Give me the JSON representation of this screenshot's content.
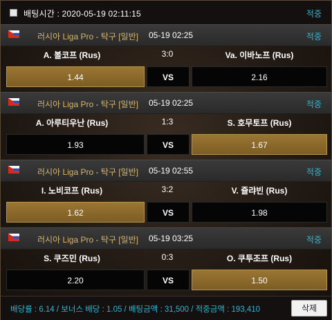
{
  "header": {
    "bet_time": "배팅시간 : 2020-05-19 02:11:15",
    "hit_label": "적중"
  },
  "games": [
    {
      "league": "러시아 Liga Pro - 탁구 [일반]",
      "time": "05-19 02:25",
      "hit_label": "적중",
      "home_team": "A. 볼코프 (Rus)",
      "score": "3:0",
      "away_team": "Va. 이바노프 (Rus)",
      "home_odds": "1.44",
      "vs_label": "VS",
      "away_odds": "2.16",
      "selected": "home"
    },
    {
      "league": "러시아 Liga Pro - 탁구 [일반]",
      "time": "05-19 02:25",
      "hit_label": "적중",
      "home_team": "A. 아루티우난 (Rus)",
      "score": "1:3",
      "away_team": "S. 호무토프 (Rus)",
      "home_odds": "1.93",
      "vs_label": "VS",
      "away_odds": "1.67",
      "selected": "away"
    },
    {
      "league": "러시아 Liga Pro - 탁구 [일반]",
      "time": "05-19 02:55",
      "hit_label": "적중",
      "home_team": "I. 노비코프 (Rus)",
      "score": "3:2",
      "away_team": "V. 쥴랴빈 (Rus)",
      "home_odds": "1.62",
      "vs_label": "VS",
      "away_odds": "1.98",
      "selected": "home"
    },
    {
      "league": "러시아 Liga Pro - 탁구 [일반]",
      "time": "05-19 03:25",
      "hit_label": "적중",
      "home_team": "S. 쿠즈민 (Rus)",
      "score": "0:3",
      "away_team": "O. 쿠투조프 (Rus)",
      "home_odds": "2.20",
      "vs_label": "VS",
      "away_odds": "1.50",
      "selected": "away"
    }
  ],
  "footer": {
    "summary": "배당률 : 6.14 / 보너스 배당 : 1.05 / 배팅금액 : 31,500 / 적중금액 : 193,410",
    "delete_label": "삭제"
  },
  "colors": {
    "hit": "#2fb6d0",
    "league": "#d9b66a",
    "selected_odds": "#8a6a2c",
    "background": "#221a14"
  },
  "icons": {
    "flag": "russia-flag-icon",
    "checkbox": "checkbox-icon"
  }
}
